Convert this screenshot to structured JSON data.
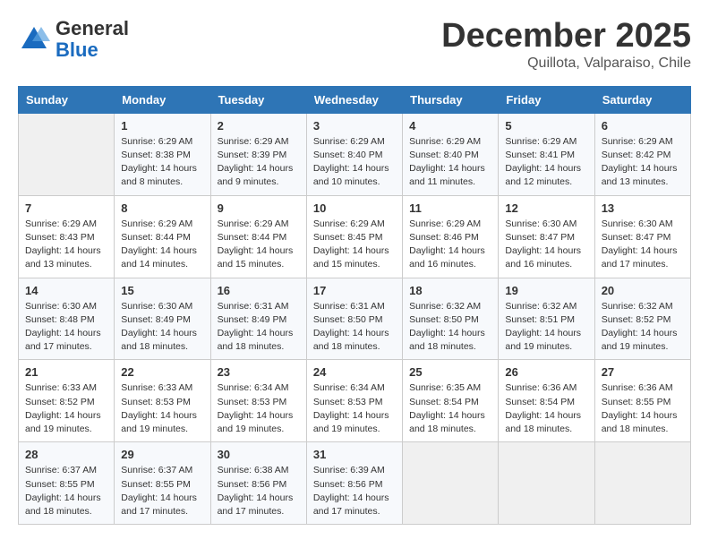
{
  "header": {
    "logo_general": "General",
    "logo_blue": "Blue",
    "month_title": "December 2025",
    "location": "Quillota, Valparaiso, Chile"
  },
  "weekdays": [
    "Sunday",
    "Monday",
    "Tuesday",
    "Wednesday",
    "Thursday",
    "Friday",
    "Saturday"
  ],
  "weeks": [
    [
      {
        "day": "",
        "info": ""
      },
      {
        "day": "1",
        "info": "Sunrise: 6:29 AM\nSunset: 8:38 PM\nDaylight: 14 hours\nand 8 minutes."
      },
      {
        "day": "2",
        "info": "Sunrise: 6:29 AM\nSunset: 8:39 PM\nDaylight: 14 hours\nand 9 minutes."
      },
      {
        "day": "3",
        "info": "Sunrise: 6:29 AM\nSunset: 8:40 PM\nDaylight: 14 hours\nand 10 minutes."
      },
      {
        "day": "4",
        "info": "Sunrise: 6:29 AM\nSunset: 8:40 PM\nDaylight: 14 hours\nand 11 minutes."
      },
      {
        "day": "5",
        "info": "Sunrise: 6:29 AM\nSunset: 8:41 PM\nDaylight: 14 hours\nand 12 minutes."
      },
      {
        "day": "6",
        "info": "Sunrise: 6:29 AM\nSunset: 8:42 PM\nDaylight: 14 hours\nand 13 minutes."
      }
    ],
    [
      {
        "day": "7",
        "info": "Sunrise: 6:29 AM\nSunset: 8:43 PM\nDaylight: 14 hours\nand 13 minutes."
      },
      {
        "day": "8",
        "info": "Sunrise: 6:29 AM\nSunset: 8:44 PM\nDaylight: 14 hours\nand 14 minutes."
      },
      {
        "day": "9",
        "info": "Sunrise: 6:29 AM\nSunset: 8:44 PM\nDaylight: 14 hours\nand 15 minutes."
      },
      {
        "day": "10",
        "info": "Sunrise: 6:29 AM\nSunset: 8:45 PM\nDaylight: 14 hours\nand 15 minutes."
      },
      {
        "day": "11",
        "info": "Sunrise: 6:29 AM\nSunset: 8:46 PM\nDaylight: 14 hours\nand 16 minutes."
      },
      {
        "day": "12",
        "info": "Sunrise: 6:30 AM\nSunset: 8:47 PM\nDaylight: 14 hours\nand 16 minutes."
      },
      {
        "day": "13",
        "info": "Sunrise: 6:30 AM\nSunset: 8:47 PM\nDaylight: 14 hours\nand 17 minutes."
      }
    ],
    [
      {
        "day": "14",
        "info": "Sunrise: 6:30 AM\nSunset: 8:48 PM\nDaylight: 14 hours\nand 17 minutes."
      },
      {
        "day": "15",
        "info": "Sunrise: 6:30 AM\nSunset: 8:49 PM\nDaylight: 14 hours\nand 18 minutes."
      },
      {
        "day": "16",
        "info": "Sunrise: 6:31 AM\nSunset: 8:49 PM\nDaylight: 14 hours\nand 18 minutes."
      },
      {
        "day": "17",
        "info": "Sunrise: 6:31 AM\nSunset: 8:50 PM\nDaylight: 14 hours\nand 18 minutes."
      },
      {
        "day": "18",
        "info": "Sunrise: 6:32 AM\nSunset: 8:50 PM\nDaylight: 14 hours\nand 18 minutes."
      },
      {
        "day": "19",
        "info": "Sunrise: 6:32 AM\nSunset: 8:51 PM\nDaylight: 14 hours\nand 19 minutes."
      },
      {
        "day": "20",
        "info": "Sunrise: 6:32 AM\nSunset: 8:52 PM\nDaylight: 14 hours\nand 19 minutes."
      }
    ],
    [
      {
        "day": "21",
        "info": "Sunrise: 6:33 AM\nSunset: 8:52 PM\nDaylight: 14 hours\nand 19 minutes."
      },
      {
        "day": "22",
        "info": "Sunrise: 6:33 AM\nSunset: 8:53 PM\nDaylight: 14 hours\nand 19 minutes."
      },
      {
        "day": "23",
        "info": "Sunrise: 6:34 AM\nSunset: 8:53 PM\nDaylight: 14 hours\nand 19 minutes."
      },
      {
        "day": "24",
        "info": "Sunrise: 6:34 AM\nSunset: 8:53 PM\nDaylight: 14 hours\nand 19 minutes."
      },
      {
        "day": "25",
        "info": "Sunrise: 6:35 AM\nSunset: 8:54 PM\nDaylight: 14 hours\nand 18 minutes."
      },
      {
        "day": "26",
        "info": "Sunrise: 6:36 AM\nSunset: 8:54 PM\nDaylight: 14 hours\nand 18 minutes."
      },
      {
        "day": "27",
        "info": "Sunrise: 6:36 AM\nSunset: 8:55 PM\nDaylight: 14 hours\nand 18 minutes."
      }
    ],
    [
      {
        "day": "28",
        "info": "Sunrise: 6:37 AM\nSunset: 8:55 PM\nDaylight: 14 hours\nand 18 minutes."
      },
      {
        "day": "29",
        "info": "Sunrise: 6:37 AM\nSunset: 8:55 PM\nDaylight: 14 hours\nand 17 minutes."
      },
      {
        "day": "30",
        "info": "Sunrise: 6:38 AM\nSunset: 8:56 PM\nDaylight: 14 hours\nand 17 minutes."
      },
      {
        "day": "31",
        "info": "Sunrise: 6:39 AM\nSunset: 8:56 PM\nDaylight: 14 hours\nand 17 minutes."
      },
      {
        "day": "",
        "info": ""
      },
      {
        "day": "",
        "info": ""
      },
      {
        "day": "",
        "info": ""
      }
    ]
  ]
}
